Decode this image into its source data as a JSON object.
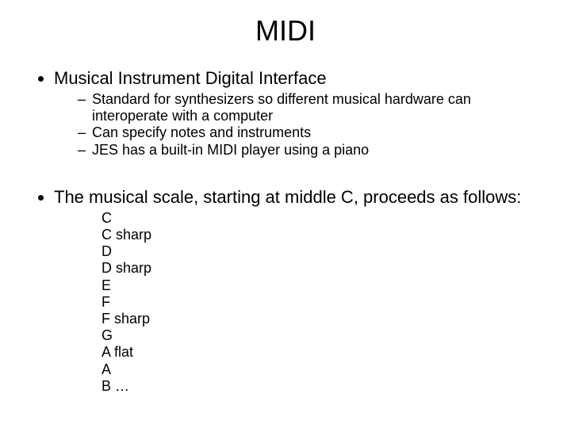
{
  "title": "MIDI",
  "bullet1": {
    "text": "Musical Instrument Digital Interface",
    "sub": [
      "Standard for synthesizers so different musical hardware can interoperate with a computer",
      "Can specify notes and instruments",
      "JES has a built-in MIDI player using a piano"
    ]
  },
  "bullet2": {
    "text": "The musical scale, starting at middle C, proceeds as follows:",
    "scale": [
      "C",
      "C sharp",
      "D",
      "D sharp",
      "E",
      "F",
      "F sharp",
      "G",
      "A flat",
      "A",
      "B …"
    ]
  }
}
